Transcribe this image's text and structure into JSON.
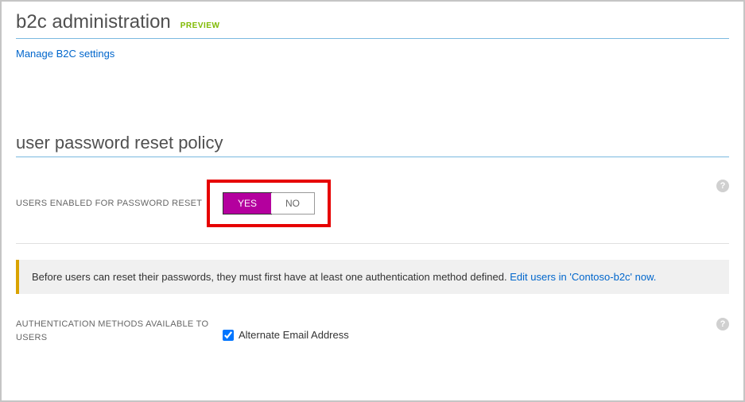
{
  "header": {
    "title": "b2c administration",
    "badge": "PREVIEW",
    "manage_link": "Manage B2C settings"
  },
  "section": {
    "title": "user password reset policy"
  },
  "password_reset": {
    "label": "USERS ENABLED FOR PASSWORD RESET",
    "yes": "YES",
    "no": "NO"
  },
  "banner": {
    "text": "Before users can reset their passwords, they must first have at least one authentication method defined. ",
    "link": "Edit users in 'Contoso-b2c' now."
  },
  "auth_methods": {
    "label": "AUTHENTICATION METHODS AVAILABLE TO USERS",
    "option1": "Alternate Email Address"
  },
  "help": "?"
}
